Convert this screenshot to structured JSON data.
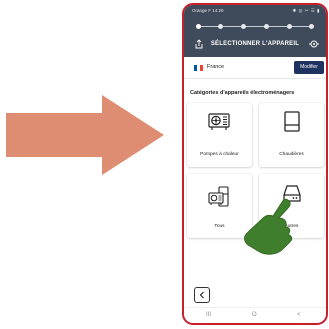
{
  "status_bar": {
    "left": "Orange F 14:20",
    "right": "✱ ◎ ✂ ☰ ▮"
  },
  "header": {
    "title": "SÉLECTIONNER L'APPAREIL",
    "left_icon": "share-icon",
    "right_icon": "settings-icon",
    "steps_total": 6,
    "steps_active": 1
  },
  "country": {
    "name": "France",
    "button_label": "Modifier",
    "flag_colors": [
      "#0055a4",
      "#ffffff",
      "#ef4135"
    ]
  },
  "section_title": "Catégories d'appareils électroménagers",
  "categories": [
    {
      "label": "Pompes à chaleur",
      "icon": "heat-pump-icon"
    },
    {
      "label": "Chaudières",
      "icon": "boiler-icon"
    },
    {
      "label": "Tous",
      "icon": "all-appliances-icon"
    },
    {
      "label": "Autres",
      "icon": "hard-drive-icon"
    }
  ],
  "back_button": {
    "icon": "chevron-left-icon"
  },
  "nav_bar": {
    "recent": "III",
    "home": "O",
    "back": "<"
  },
  "colors": {
    "arrow": "#de8c72",
    "phone_border": "#c8202a",
    "header_bg": "#3f4a5a",
    "button_bg": "#1f3260",
    "hand": "#3f7e2c"
  }
}
